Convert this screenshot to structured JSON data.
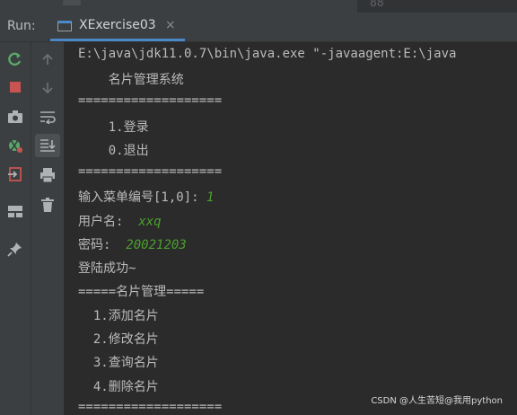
{
  "top_strip": {
    "line_number": "88"
  },
  "run_panel": {
    "run_label": "Run:",
    "tab_label": "XExercise03",
    "tab_close": "×"
  },
  "toolbar": {
    "left": [
      "rerun-icon",
      "stop-icon",
      "camera-icon",
      "debug-settings-icon",
      "exit-icon",
      "layout-icon",
      "pin-icon"
    ],
    "right": [
      "up-icon",
      "down-icon",
      "soft-wrap-icon",
      "scroll-to-end-icon",
      "print-icon",
      "trash-icon"
    ]
  },
  "console": {
    "cmd": "E:\\java\\jdk11.0.7\\bin\\java.exe \"-javaagent:E:\\java",
    "title": "    名片管理系统",
    "sep1": "===================",
    "opt_login": "    1.登录",
    "opt_exit": "    0.退出",
    "sep2": "===================",
    "prompt_menu": "输入菜单编号[1,0]: ",
    "input_menu": "1",
    "prompt_user": "用户名:  ",
    "input_user": "xxq",
    "prompt_pwd": "密码:  ",
    "input_pwd": "20021203",
    "login_ok": "登陆成功~",
    "mgmt_title": "=====名片管理=====",
    "m1": "  1.添加名片",
    "m2": "  2.修改名片",
    "m3": "  3.查询名片",
    "m4": "  4.删除名片",
    "sep3": "==================="
  },
  "watermark": "CSDN @人生苦短@我用python",
  "colors": {
    "accent": "#4a88c7",
    "user_input": "#4aa02c",
    "background": "#2b2b2b"
  }
}
